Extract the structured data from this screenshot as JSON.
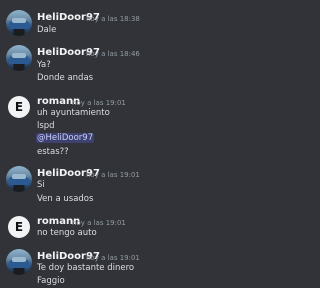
{
  "messages": [
    {
      "author": "HeliDoor97",
      "time": "hoy a las 18:38",
      "avatar": "car-avatar",
      "lines": [
        "Dale"
      ]
    },
    {
      "author": "HeliDoor97",
      "time": "hoy a las 18:46",
      "avatar": "car-avatar",
      "lines": [
        "Ya?",
        "Donde andas"
      ]
    },
    {
      "author": "romann",
      "time": "hoy a las 19:01",
      "avatar_letter": "E",
      "lines": [
        "uh ayuntamiento",
        "lspd"
      ],
      "mention": "@HeliDoor97",
      "after": "estas??"
    },
    {
      "author": "HeliDoor97",
      "time": "hoy a las 19:01",
      "avatar": "car-avatar",
      "lines": [
        "Si",
        "Ven a usados"
      ]
    },
    {
      "author": "romann",
      "time": "hoy a las 19:01",
      "avatar_letter": "E",
      "lines": [
        "no tengo auto"
      ]
    },
    {
      "author": "HeliDoor97",
      "time": "hoy a las 19:01",
      "avatar": "car-avatar",
      "lines": [
        "Te doy bastante dinero",
        "Faggio"
      ]
    }
  ]
}
